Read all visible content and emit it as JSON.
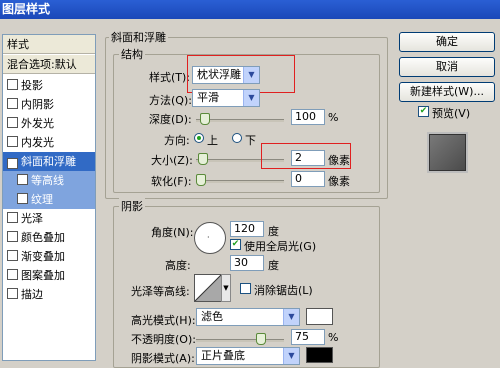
{
  "window": {
    "title": "图层样式"
  },
  "left_panel": {
    "header1": "样式",
    "header2": "混合选项:默认",
    "items": [
      {
        "label": "投影",
        "checked": false
      },
      {
        "label": "内阴影",
        "checked": false
      },
      {
        "label": "外发光",
        "checked": false
      },
      {
        "label": "内发光",
        "checked": false
      },
      {
        "label": "斜面和浮雕",
        "checked": true
      },
      {
        "label": "等高线",
        "checked": false
      },
      {
        "label": "纹理",
        "checked": false
      },
      {
        "label": "光泽",
        "checked": false
      },
      {
        "label": "颜色叠加",
        "checked": false
      },
      {
        "label": "渐变叠加",
        "checked": false
      },
      {
        "label": "图案叠加",
        "checked": false
      },
      {
        "label": "描边",
        "checked": false
      }
    ]
  },
  "bevel": {
    "group_title": "斜面和浮雕",
    "structure_title": "结构",
    "style_label": "样式(T):",
    "style_value": "枕状浮雕",
    "technique_label": "方法(Q):",
    "technique_value": "平滑",
    "depth_label": "深度(D):",
    "depth_value": "100",
    "depth_unit": "%",
    "depth_level": 0.05,
    "direction_label": "方向:",
    "direction_up": "上",
    "direction_down": "下",
    "direction_selected": "up",
    "size_label": "大小(Z):",
    "size_value": "2",
    "size_unit": "像素",
    "size_level": 0.02,
    "soften_label": "软化(F):",
    "soften_value": "0",
    "soften_unit": "像素",
    "soften_level": 0.0
  },
  "shading": {
    "title": "阴影",
    "angle_label": "角度(N):",
    "angle_value": "120",
    "angle_unit": "度",
    "global_light_label": "使用全局光(G)",
    "global_light_checked": true,
    "altitude_label": "高度:",
    "altitude_value": "30",
    "altitude_unit": "度",
    "gloss_contour_label": "光泽等高线:",
    "antialiased_label": "消除锯齿(L)",
    "antialiased_checked": false,
    "highlight_mode_label": "高光模式(H):",
    "highlight_mode_value": "滤色",
    "highlight_color": "#ffffff",
    "opacity_label": "不透明度(O):",
    "opacity_value": "75",
    "opacity_unit": "%",
    "opacity_level": 0.75,
    "shadow_mode_label": "阴影模式(A):",
    "shadow_mode_value": "正片叠底",
    "shadow_color": "#000000"
  },
  "buttons": {
    "ok": "确定",
    "cancel": "取消",
    "new_style": "新建样式(W)...",
    "preview_label": "预览(V)",
    "preview_checked": true
  }
}
